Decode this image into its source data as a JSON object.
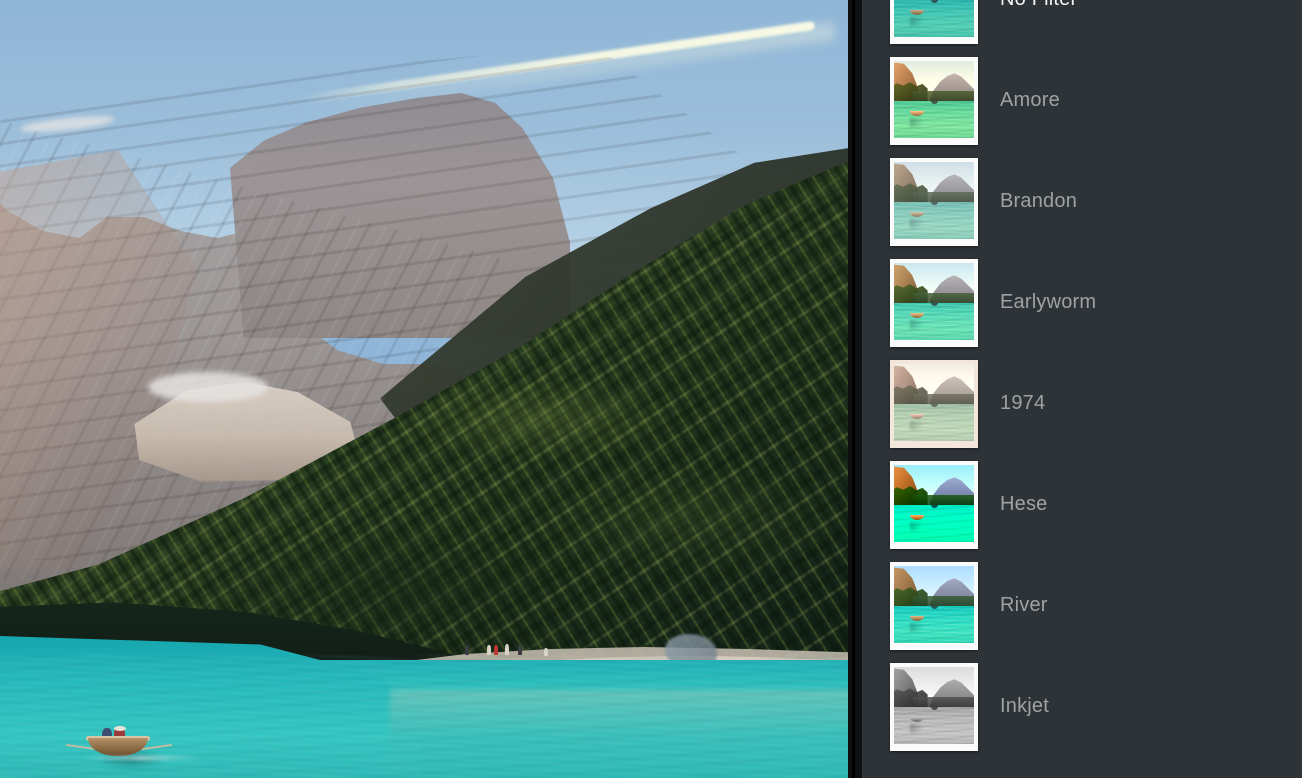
{
  "app": {
    "name": "photo-filter-editor",
    "panel_background": "#2e3337",
    "divider_color": "#000000"
  },
  "photo": {
    "alt": "Turquoise alpine lake with rowboat below a rocky mountain and pine forest",
    "scene_elements": [
      "sky",
      "contrail",
      "limestone-mountain",
      "snow-patch",
      "scree-slope",
      "pine-forest-slope",
      "beach",
      "turquoise-lake",
      "rowboat",
      "beachgoers"
    ],
    "colors": {
      "sky": "#9cbeda",
      "rock": "#a39c9c",
      "forest": "#2f4424",
      "forest_highlight": "#9aa24b",
      "lake": "#2cc0bd",
      "beach": "#d6cec1"
    }
  },
  "filter_panel": {
    "selected_index": 0,
    "selected_label_color": "#f2f4f5",
    "label_color": "#9ea2a4",
    "filters": [
      {
        "label": "No Filter",
        "look": "look-none",
        "selected": true
      },
      {
        "label": "Amore",
        "look": "look-amore",
        "selected": false
      },
      {
        "label": "Brandon",
        "look": "look-brandon",
        "selected": false
      },
      {
        "label": "Earlyworm",
        "look": "look-early",
        "selected": false
      },
      {
        "label": "1974",
        "look": "look-1974",
        "selected": false
      },
      {
        "label": "Hese",
        "look": "look-hese",
        "selected": false
      },
      {
        "label": "River",
        "look": "look-river",
        "selected": false
      },
      {
        "label": "Inkjet",
        "look": "look-inkjet",
        "selected": false
      }
    ]
  }
}
